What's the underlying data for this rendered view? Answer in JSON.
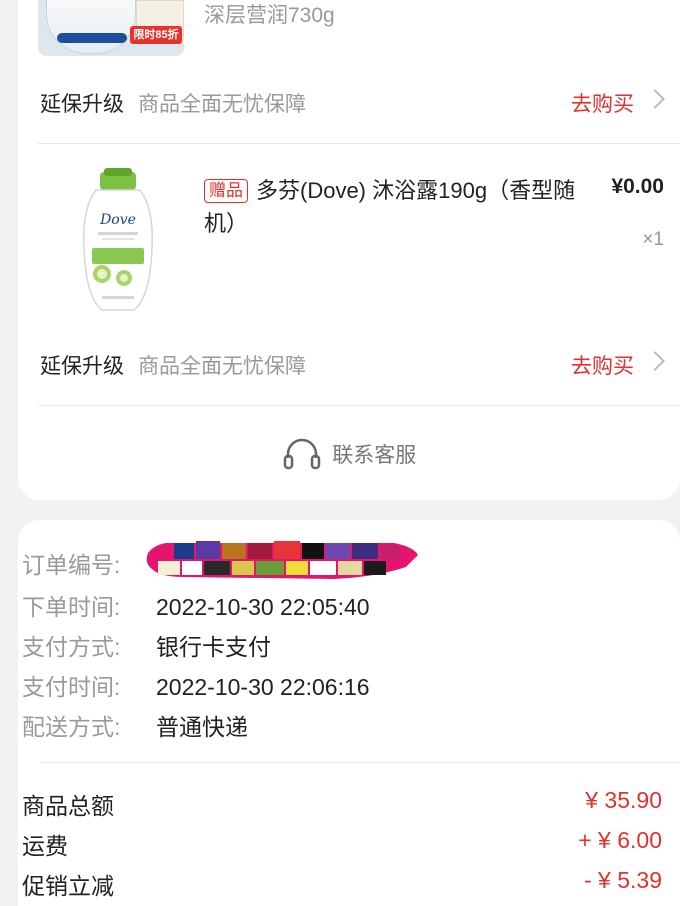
{
  "top_product": {
    "spec": "深层营润730g",
    "promo_badge": "限时85折"
  },
  "warranty": {
    "title": "延保升级",
    "description": "商品全面无忧保障",
    "action": "去购买"
  },
  "gift_product": {
    "tag": "赠品",
    "title": "多芬(Dove) 沐浴露190g（香型随机）",
    "price": "¥0.00",
    "quantity": "×1",
    "brand_on_bottle": "Dove"
  },
  "customer_service": {
    "label": "联系客服",
    "icon": "headset-icon"
  },
  "order_info": [
    {
      "key": "订单编号:",
      "value": ""
    },
    {
      "key": "下单时间:",
      "value": "2022-10-30 22:05:40"
    },
    {
      "key": "支付方式:",
      "value": "银行卡支付"
    },
    {
      "key": "支付时间:",
      "value": "2022-10-30 22:06:16"
    },
    {
      "key": "配送方式:",
      "value": "普通快递"
    }
  ],
  "summary": [
    {
      "key": "商品总额",
      "value": "¥ 35.90"
    },
    {
      "key": "运费",
      "value": "+ ¥ 6.00"
    },
    {
      "key": "促销立减",
      "value": "- ¥ 5.39"
    }
  ],
  "colors": {
    "accent_red": "#e1322d",
    "muted_gray": "#999999",
    "background": "#f2f2f2"
  }
}
